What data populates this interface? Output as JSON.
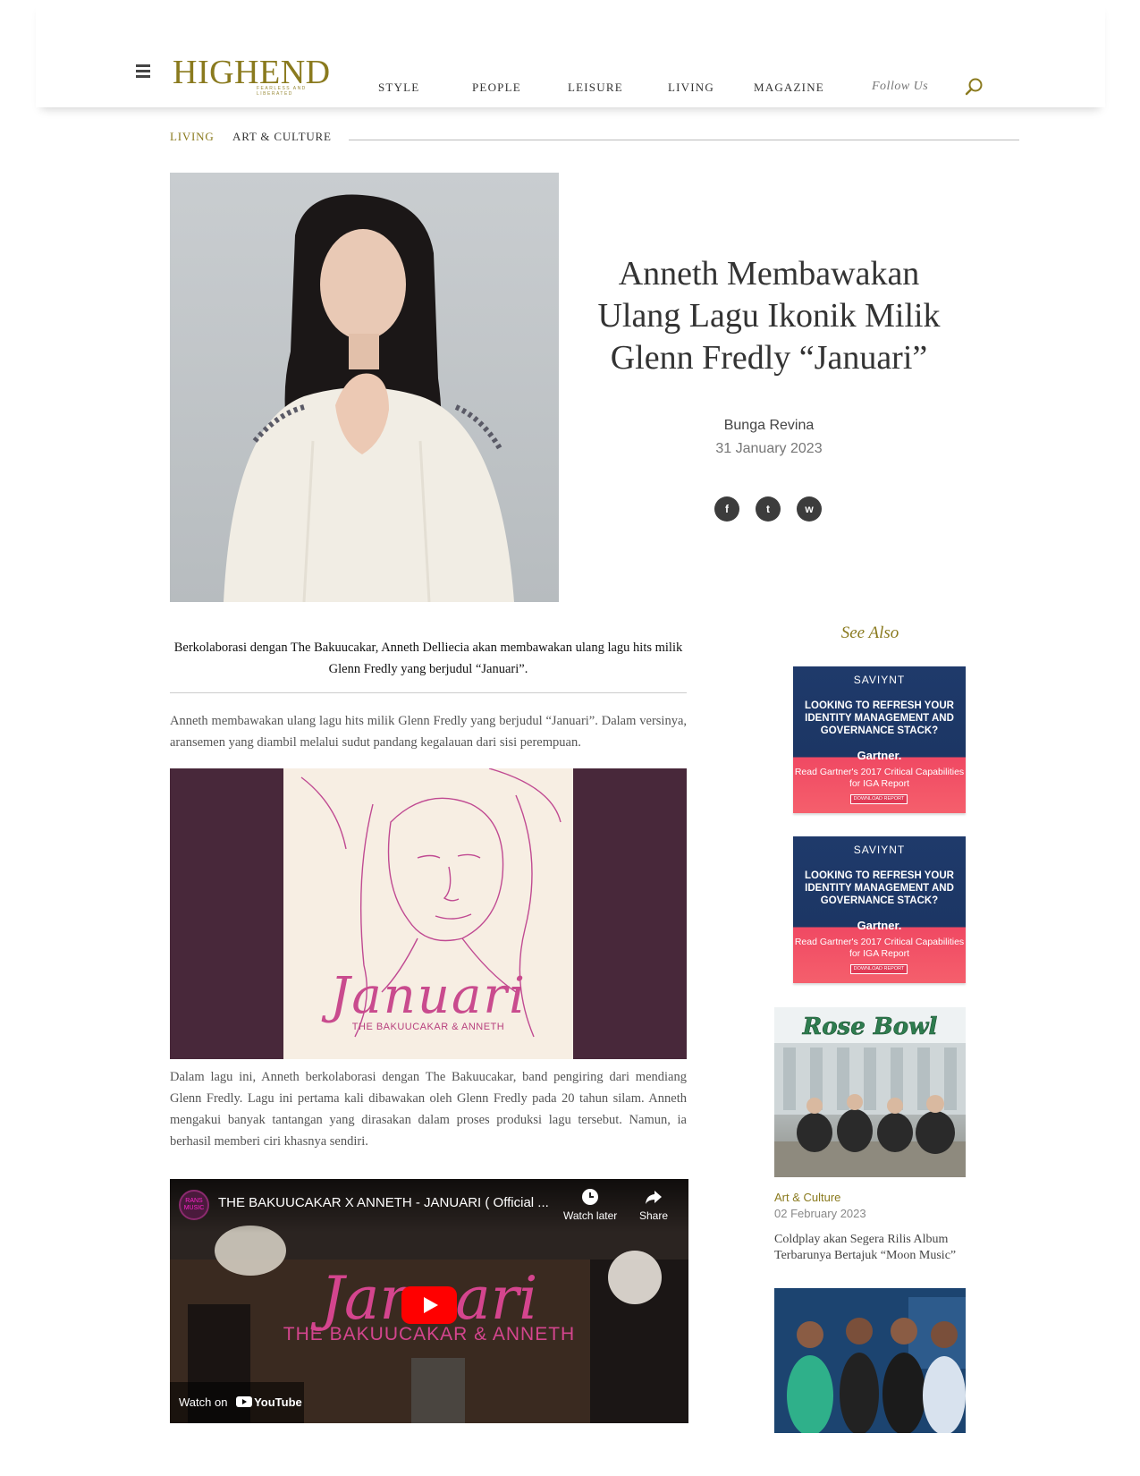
{
  "header": {
    "logo": "HIGHEND",
    "logo_tagline": "FEARLESS AND LIBERATED",
    "nav": [
      "STYLE",
      "PEOPLE",
      "LEISURE",
      "LIVING",
      "MAGAZINE"
    ],
    "follow_label": "Follow Us"
  },
  "breadcrumb": [
    "LIVING",
    "ART & CULTURE"
  ],
  "article": {
    "title": "Anneth Membawakan Ulang Lagu Ikonik Milik Glenn Fredly “Januari”",
    "author": "Bunga Revina",
    "date": "31 January 2023",
    "share": [
      {
        "icon": "facebook-icon",
        "glyph": "f"
      },
      {
        "icon": "twitter-icon",
        "glyph": "t"
      },
      {
        "icon": "whatsapp-icon",
        "glyph": "w"
      }
    ],
    "lead": "Berkolaborasi dengan The Bakuucakar, Anneth Delliecia akan membawakan ulang lagu hits milik Glenn Fredly yang berjudul “Januari”.",
    "para1": "Anneth membawakan ulang lagu hits milik Glenn Fredly yang berjudul “Januari”. Dalam versinya, aransemen yang diambil melalui sudut pandang kegalauan dari sisi perempuan.",
    "cover": {
      "title": "Januari",
      "subtitle": "THE BAKUUCAKAR & ANNETH"
    },
    "para2": "Dalam lagu ini, Anneth berkolaborasi dengan The Bakuucakar, band pengiring dari mendiang Glenn Fredly. Lagu ini pertama kali dibawakan oleh Glenn Fredly pada 20 tahun silam. Anneth mengakui banyak tantangan yang dirasakan dalam proses produksi lagu tersebut. Namun, ia berhasil memberi ciri khasnya sendiri."
  },
  "video": {
    "channel": "RANS MUSIC",
    "title": "THE BAKUUCAKAR X ANNETH - JANUARI ( Official ...",
    "watch_later": "Watch later",
    "share": "Share",
    "overlay_title": "Januari",
    "overlay_sub": "THE BAKUUCAKAR & ANNETH",
    "watch_on": "Watch on",
    "youtube": "YouTube"
  },
  "sidebar": {
    "heading": "See Also",
    "ad": {
      "brand": "SAVIYNT",
      "headline": "LOOKING TO REFRESH YOUR IDENTITY MANAGEMENT AND GOVERNANCE STACK?",
      "partner": "Gartner.",
      "text": "Read Gartner's 2017 Critical Capabilities for IGA Report",
      "cta": "DOWNLOAD REPORT"
    },
    "story": {
      "category": "Art & Culture",
      "date": "02 February 2023",
      "title": "Coldplay akan Segera Rilis Album Terbarunya Bertajuk “Moon Music”",
      "sign_text": "Rose Bowl"
    }
  }
}
